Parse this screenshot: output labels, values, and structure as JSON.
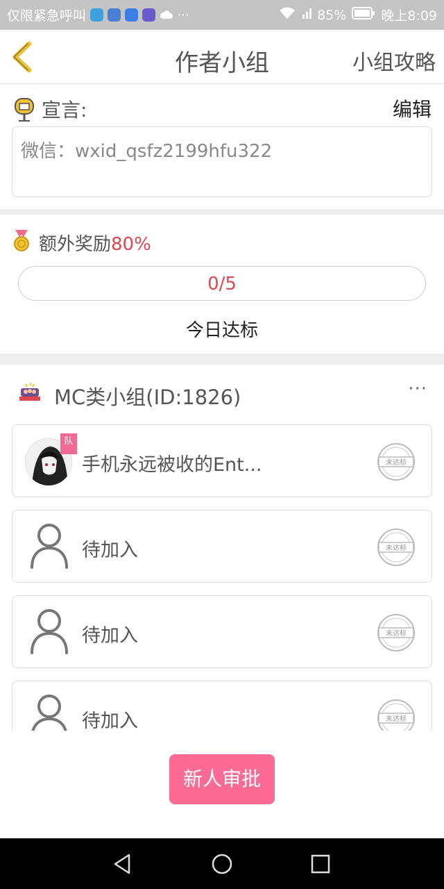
{
  "status_bar": {
    "left_text": "仅限紧急呼叫",
    "battery": "85%",
    "time": "晚上8:09",
    "app_icons": [
      "shield-icon",
      "signal-app-icon",
      "paw-icon",
      "chat-app-icon",
      "cloud-icon"
    ],
    "ellipsis": "···"
  },
  "header": {
    "title": "作者小组",
    "right_label": "小组攻略"
  },
  "declaration": {
    "label": "宣言:",
    "edit_label": "编辑",
    "text": "微信：wxid_qsfz2199hfu322"
  },
  "reward": {
    "label": "额外奖励",
    "percent": "80%",
    "progress_text": "0/5",
    "progress_value": 0,
    "today_label": "今日达标"
  },
  "group": {
    "name": "MC类小组(ID:1826)",
    "more": "···"
  },
  "members": [
    {
      "name": "手机永远被收的Ent...",
      "badge": "队",
      "stamp": "未达标",
      "type": "avatar"
    },
    {
      "name": "待加入",
      "stamp": "未达标",
      "type": "placeholder"
    },
    {
      "name": "待加入",
      "stamp": "未达标",
      "type": "placeholder"
    },
    {
      "name": "待加入",
      "stamp": "未达标",
      "type": "placeholder"
    }
  ],
  "approve_button": "新人审批",
  "colors": {
    "accent_pink": "#fb6b93",
    "reward_red": "#e0464f",
    "status_bar": "#c4c4c4",
    "back_chevron": "#e8c23a"
  }
}
